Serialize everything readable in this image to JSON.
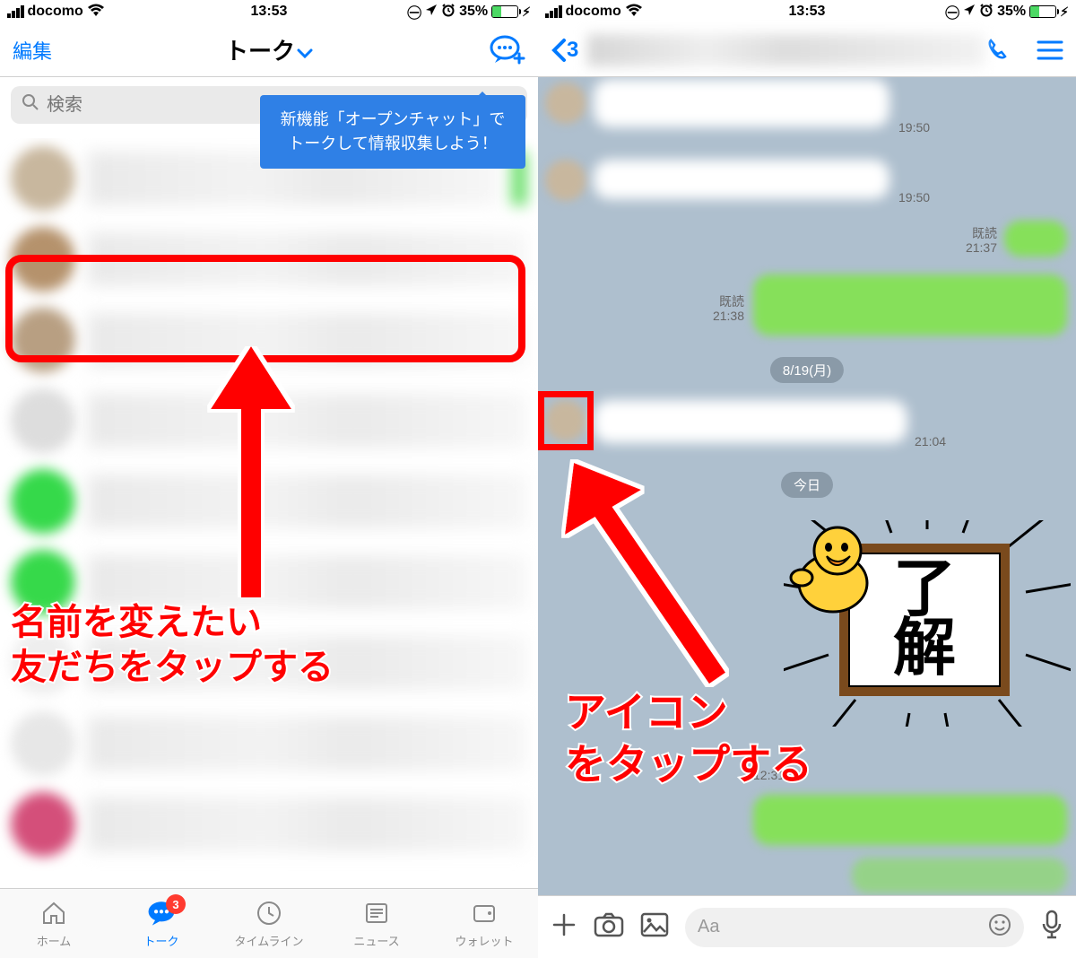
{
  "statusbar": {
    "carrier": "docomo",
    "time": "13:53",
    "battery_pct": "35%"
  },
  "left": {
    "nav": {
      "edit": "編集",
      "title": "トーク"
    },
    "search_placeholder": "検索",
    "tooltip": "新機能「オープンチャット」で\nトークして情報収集しよう！",
    "tabs": {
      "home": "ホーム",
      "talk": "トーク",
      "timeline": "タイムライン",
      "news": "ニュース",
      "wallet": "ウォレット",
      "badge": "3"
    },
    "caption": "名前を変えたい\n友だちをタップする"
  },
  "right": {
    "back_count": "3",
    "times": {
      "t1": "19:50",
      "t2": "19:50",
      "t3": "21:37",
      "t4": "21:38",
      "t5": "21:04",
      "t6": "12:31"
    },
    "read_label": "既読",
    "date1": "8/19(月)",
    "date2": "今日",
    "sticker_text_a": "了",
    "sticker_text_b": "解",
    "composer_placeholder": "Aa",
    "caption": "アイコン\nをタップする"
  }
}
